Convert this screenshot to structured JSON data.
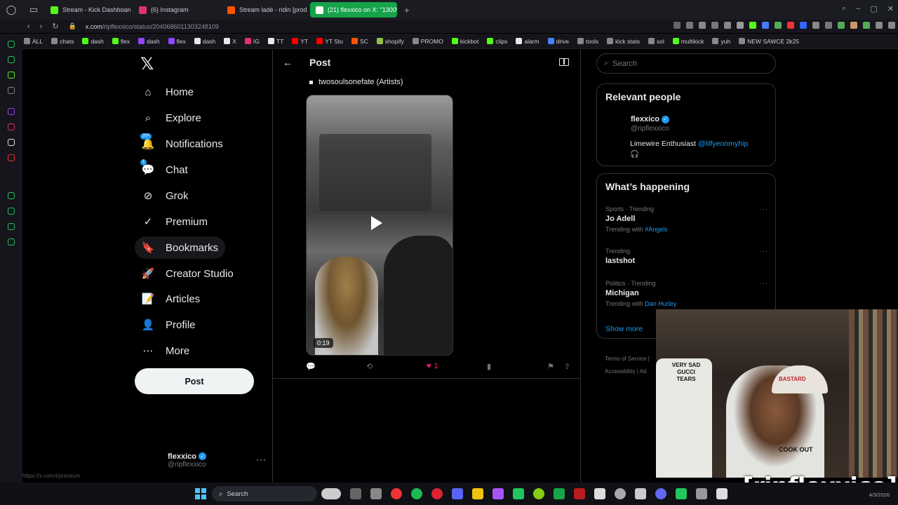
{
  "browser": {
    "tabs": [
      {
        "label": "Stream - Kick Dashboard",
        "color": "#53fc18",
        "active": false
      },
      {
        "label": "(6) Instagram",
        "color": "#e1306c",
        "active": false
      },
      {
        "label": "Stream ladé - ridin [prod.",
        "color": "#ff5500",
        "active": false
      },
      {
        "label": "(21) flexxico on X: \"1300%",
        "color": "#ffffff",
        "active": true
      }
    ],
    "url_host": "x.com",
    "url_path": "/ripflexxico/status/2040686011303248109",
    "bookmarks": [
      {
        "label": "ALL",
        "color": "#888"
      },
      {
        "label": "chats",
        "color": "#888"
      },
      {
        "label": "dash",
        "color": "#53fc18"
      },
      {
        "label": "flex",
        "color": "#53fc18"
      },
      {
        "label": "dash",
        "color": "#9146ff"
      },
      {
        "label": "flex",
        "color": "#9146ff"
      },
      {
        "label": "dash",
        "color": "#e7e9ea"
      },
      {
        "label": "X",
        "color": "#e7e9ea"
      },
      {
        "label": "IG",
        "color": "#e1306c"
      },
      {
        "label": "TT",
        "color": "#e7e9ea"
      },
      {
        "label": "YT",
        "color": "#ff0000"
      },
      {
        "label": "YT Stu",
        "color": "#ff0000"
      },
      {
        "label": "SC",
        "color": "#ff5500"
      },
      {
        "label": "shopify",
        "color": "#95bf47"
      },
      {
        "label": "PROMO",
        "color": "#888"
      },
      {
        "label": "kickbot",
        "color": "#53fc18"
      },
      {
        "label": "clips",
        "color": "#53fc18"
      },
      {
        "label": "alarm",
        "color": "#e7e9ea"
      },
      {
        "label": "drive",
        "color": "#4285f4"
      },
      {
        "label": "tools",
        "color": "#888"
      },
      {
        "label": "kick stats",
        "color": "#888"
      },
      {
        "label": "sol",
        "color": "#888"
      },
      {
        "label": "multikick",
        "color": "#53fc18"
      },
      {
        "label": "yuh",
        "color": "#888"
      },
      {
        "label": "NEW SAWCE 2k25",
        "color": "#888"
      }
    ],
    "status_url": "https://x.com/i/premium",
    "clock": "4/3/2026"
  },
  "nav": {
    "items": [
      {
        "label": "Home",
        "icon": "home-icon",
        "glyph": "⌂"
      },
      {
        "label": "Explore",
        "icon": "search-icon",
        "glyph": "⌕"
      },
      {
        "label": "Notifications",
        "icon": "bell-icon",
        "glyph": "🔔",
        "badge": "20+"
      },
      {
        "label": "Chat",
        "icon": "chat-icon",
        "glyph": "💬",
        "badge": "1"
      },
      {
        "label": "Grok",
        "icon": "grok-icon",
        "glyph": "⊘"
      },
      {
        "label": "Premium",
        "icon": "premium-icon",
        "glyph": "✓"
      },
      {
        "label": "Bookmarks",
        "icon": "bookmark-icon",
        "glyph": "🔖"
      },
      {
        "label": "Creator Studio",
        "icon": "rocket-icon",
        "glyph": "🚀"
      },
      {
        "label": "Articles",
        "icon": "articles-icon",
        "glyph": "📝"
      },
      {
        "label": "Profile",
        "icon": "profile-icon",
        "glyph": "👤"
      },
      {
        "label": "More",
        "icon": "more-icon",
        "glyph": "⋯"
      }
    ],
    "post_button": "Post",
    "account": {
      "name": "flexxico",
      "handle": "@ripflexxico"
    }
  },
  "post": {
    "header_title": "Post",
    "bullet_text": "twosoulsonefate (Artists)",
    "video_duration": "0:19",
    "like_count": "1"
  },
  "sidebar": {
    "search_placeholder": "Search",
    "relevant_title": "Relevant people",
    "person": {
      "name": "flexxico",
      "handle": "@ripflexxico",
      "bio": "Limewire Enthusiast",
      "bio_link": "@lilfyeonmyhip",
      "bio_emoji": "🎧"
    },
    "happening_title": "What’s happening",
    "trends": [
      {
        "meta": "Sports · Trending",
        "name": "Jo Adell",
        "with_label": "Trending with",
        "with_value": "#Angels"
      },
      {
        "meta": "Trending",
        "name": "lastshot",
        "with_label": "",
        "with_value": ""
      },
      {
        "meta": "Politics · Trending",
        "name": "Michigan",
        "with_label": "Trending with",
        "with_value": "Dan Hurley"
      }
    ],
    "show_more": "Show more",
    "footer1": "Terms of Service",
    "footer2": "Accessibility",
    "footer3": "Ad"
  },
  "overlay": {
    "watermark": "[ripflexxico]",
    "hat_text": "BASTARD",
    "shirt_text": "VERY SAD GUCCI TEARS",
    "shirt2_text": "COOK OUT"
  },
  "taskbar": {
    "search_label": "Search"
  }
}
